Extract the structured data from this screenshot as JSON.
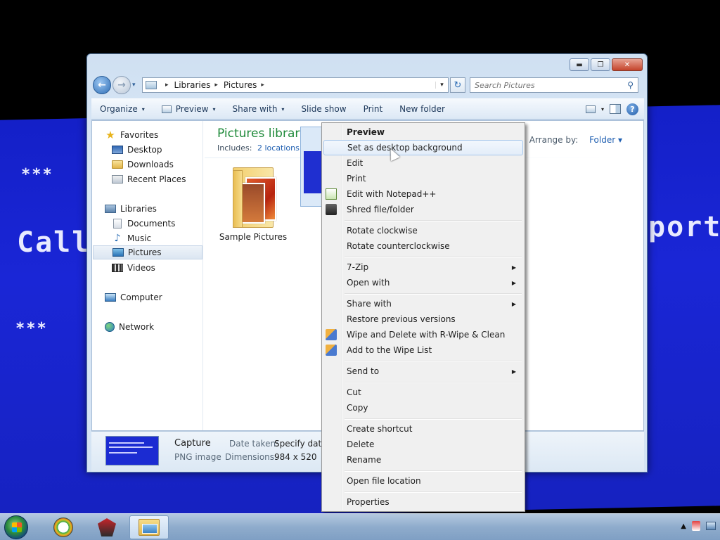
{
  "desktop": {
    "bsod_lines": [
      "***",
      "Call",
      "***  ",
      "port"
    ]
  },
  "window": {
    "caption_buttons": {
      "minimize": "▬",
      "maximize": "❐",
      "close": "✕"
    },
    "address": {
      "crumbs": [
        "Libraries",
        "Pictures"
      ],
      "separator": "▸"
    },
    "search": {
      "placeholder": "Search Pictures"
    },
    "toolbar": {
      "organize": "Organize",
      "preview": "Preview",
      "share_with": "Share with",
      "slide_show": "Slide show",
      "print": "Print",
      "new_folder": "New folder",
      "caret": "▾"
    },
    "sidebar": {
      "favorites": "Favorites",
      "desktop": "Desktop",
      "downloads": "Downloads",
      "recent_places": "Recent Places",
      "libraries": "Libraries",
      "documents": "Documents",
      "music": "Music",
      "pictures": "Pictures",
      "videos": "Videos",
      "computer": "Computer",
      "network": "Network"
    },
    "content": {
      "title": "Pictures library",
      "includes_label": "Includes:",
      "includes_link": "2 locations",
      "arrange_label": "Arrange by:",
      "arrange_value": "Folder ▾",
      "items": [
        {
          "name": "Sample Pictures",
          "type": "folder"
        },
        {
          "name": "Capture",
          "type": "image"
        }
      ]
    },
    "details": {
      "name": "Capture",
      "type": "PNG image",
      "date_taken_label": "Date taken:",
      "date_taken_value": "Specify date ta",
      "dimensions_label": "Dimensions:",
      "dimensions_value": "984 x 520"
    }
  },
  "context_menu": {
    "preview": "Preview",
    "set_desktop_bg": "Set as desktop background",
    "edit": "Edit",
    "print": "Print",
    "edit_notepadpp": "Edit with Notepad++",
    "shred": "Shred file/folder",
    "rotate_cw": "Rotate clockwise",
    "rotate_ccw": "Rotate counterclockwise",
    "seven_zip": "7-Zip",
    "open_with": "Open with",
    "share_with": "Share with",
    "restore_versions": "Restore previous versions",
    "wipe_delete": "Wipe and Delete with R-Wipe & Clean",
    "add_wipe_list": "Add to the Wipe List",
    "send_to": "Send to",
    "cut": "Cut",
    "copy": "Copy",
    "create_shortcut": "Create shortcut",
    "delete": "Delete",
    "rename": "Rename",
    "open_location": "Open file location",
    "properties": "Properties",
    "submenu_arrow": "▶"
  },
  "taskbar": {
    "tray_arrow": "▲"
  },
  "colors": {
    "library_title": "#1f8a3a",
    "link": "#1f5fb1",
    "bsod": "#1a26d6"
  }
}
